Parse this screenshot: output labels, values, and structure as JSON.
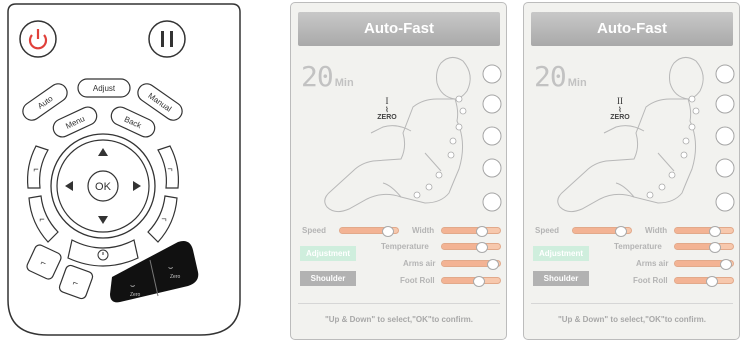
{
  "remote": {
    "ok_label": "OK",
    "buttons": {
      "auto": "Auto",
      "adjust": "Adjust",
      "manual": "Manual",
      "menu": "Menu",
      "back": "Back",
      "zero1": "Zero",
      "zero2": "Zero"
    }
  },
  "panels": [
    {
      "title": "Auto-Fast",
      "timer_value": "20",
      "timer_unit": "Min",
      "zero_numeral": "I",
      "zero_label": "ZERO",
      "labels": {
        "speed": "Speed",
        "width": "Width",
        "temperature": "Temperature",
        "arms_air": "Arms air",
        "foot_roll": "Foot Roll"
      },
      "levels": {
        "speed": 0.9,
        "width": 0.75,
        "temperature": 0.75,
        "arms_air": 0.95,
        "foot_roll": 0.7
      },
      "adjustment": "Adjustment",
      "shoulder": "Shoulder",
      "hint": "\"Up & Down\" to select,\"OK\"to confirm."
    },
    {
      "title": "Auto-Fast",
      "timer_value": "20",
      "timer_unit": "Min",
      "zero_numeral": "II",
      "zero_label": "ZERO",
      "labels": {
        "speed": "Speed",
        "width": "Width",
        "temperature": "Temperature",
        "arms_air": "Arms air",
        "foot_roll": "Foot Roll"
      },
      "levels": {
        "speed": 0.9,
        "width": 0.75,
        "temperature": 0.75,
        "arms_air": 0.95,
        "foot_roll": 0.7
      },
      "adjustment": "Adjustment",
      "shoulder": "Shoulder",
      "hint": "\"Up & Down\" to select,\"OK\"to confirm."
    }
  ],
  "colors": {
    "power": "#e0403a",
    "slider": "#f3b394",
    "header": "#b4b4b4",
    "adjust_bg": "#cfeedd"
  }
}
